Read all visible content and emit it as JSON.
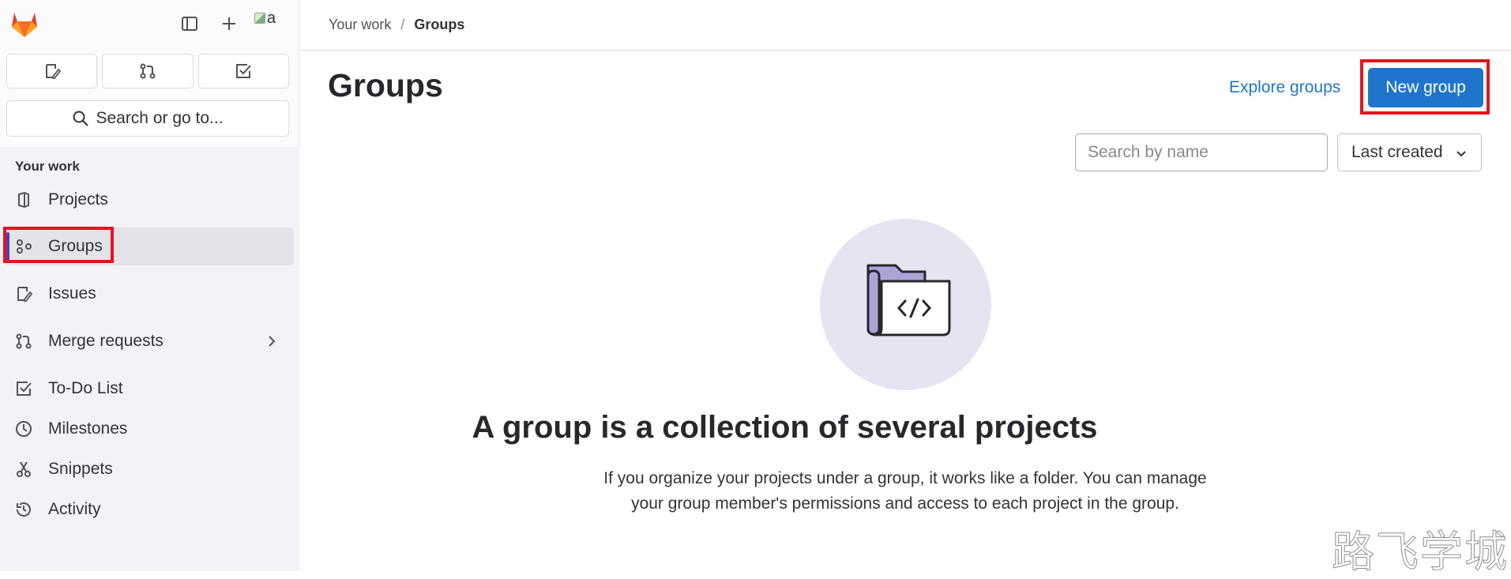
{
  "sidebar": {
    "avatar_alt": "a",
    "search_label": "Search or go to...",
    "section_title": "Your work",
    "items": [
      {
        "label": "Projects"
      },
      {
        "label": "Groups"
      },
      {
        "label": "Issues"
      },
      {
        "label": "Merge requests"
      },
      {
        "label": "To-Do List"
      },
      {
        "label": "Milestones"
      },
      {
        "label": "Snippets"
      },
      {
        "label": "Activity"
      }
    ]
  },
  "breadcrumb": {
    "parent": "Your work",
    "separator": "/",
    "current": "Groups"
  },
  "header": {
    "title": "Groups",
    "explore_label": "Explore groups",
    "new_group_label": "New group"
  },
  "filters": {
    "search_placeholder": "Search by name",
    "sort_selected": "Last created"
  },
  "empty_state": {
    "title": "A group is a collection of several projects",
    "description": "If you organize your projects under a group, it works like a folder. You can manage your group member's permissions and access to each project in the group."
  },
  "watermark": "路飞学城",
  "colors": {
    "accent": "#1f75cb",
    "highlight": "#e3141f",
    "active_indicator": "#4a3fb5"
  }
}
